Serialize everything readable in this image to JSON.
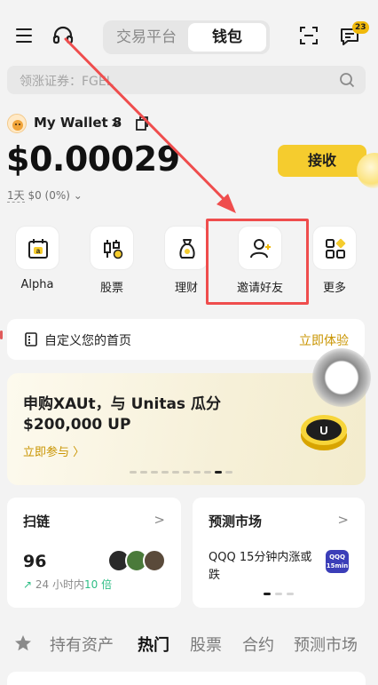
{
  "header": {
    "tabs": [
      "交易平台",
      "钱包"
    ],
    "active_tab": "钱包",
    "chat_badge": "23"
  },
  "search": {
    "placeholder": "领涨证券：FGEL"
  },
  "wallet": {
    "name": "My Wallet 8",
    "balance": "$0.00029",
    "period": "1天",
    "change": "$0 (0%)",
    "receive_label": "接收"
  },
  "quick_actions": [
    {
      "label": "Alpha",
      "icon": "alpha-icon"
    },
    {
      "label": "股票",
      "icon": "stocks-icon"
    },
    {
      "label": "理财",
      "icon": "earn-bag-icon"
    },
    {
      "label": "邀请好友",
      "icon": "invite-friend-icon"
    },
    {
      "label": "更多",
      "icon": "more-grid-icon"
    }
  ],
  "customize": {
    "label": "自定义您的首页",
    "cta": "立即体验"
  },
  "promo": {
    "title": "申购XAUt，与 Unitas 瓜分",
    "amount": "$200,000 UP",
    "cta": "立即参与 〉",
    "slides_total": 10,
    "active_slide": 8
  },
  "cards": {
    "scan": {
      "title": "扫链",
      "value": "96",
      "sub_prefix": "24 小时内",
      "sub_highlight": "10 倍"
    },
    "predict": {
      "title": "预测市场",
      "text": "QQQ 15分钟内涨或跌",
      "badge_line1": "QQQ",
      "badge_line2": "15min"
    }
  },
  "bottom_tabs": [
    "持有资产",
    "热门",
    "股票",
    "合约",
    "预测市场"
  ],
  "bottom_active": "热门",
  "colors": {
    "accent": "#f5cc2e",
    "link": "#c99400",
    "positive": "#2ebd85",
    "annotation": "#ef4d4d"
  }
}
